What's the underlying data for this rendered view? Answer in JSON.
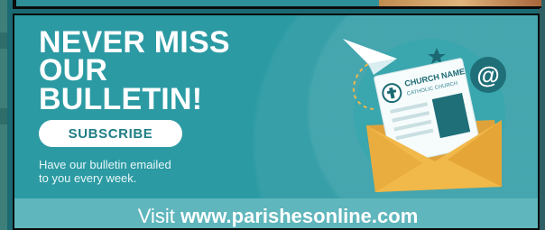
{
  "ad": {
    "headline_line1": "NEVER MISS",
    "headline_line2": "OUR BULLETIN!",
    "subscribe_label": "SUBSCRIBE",
    "description_line1": "Have our bulletin emailed",
    "description_line2": "to you every week.",
    "visit_prefix": "Visit ",
    "visit_url": "www.parishesonline.com",
    "bulletin_masthead_line1": "CHURCH NAME",
    "bulletin_masthead_line2": "CATHOLIC CHURCH",
    "at_symbol": "@"
  },
  "colors": {
    "background_teal": "#2b9aa3",
    "visit_bar": "#5fb6bc",
    "envelope_yellow": "#f1b84a",
    "subscribe_text": "#1f7e85"
  },
  "icons": [
    "paper-plane-icon",
    "star-icon",
    "at-symbol-icon",
    "envelope-icon",
    "bulletin-newsletter-icon",
    "church-logo-icon"
  ]
}
